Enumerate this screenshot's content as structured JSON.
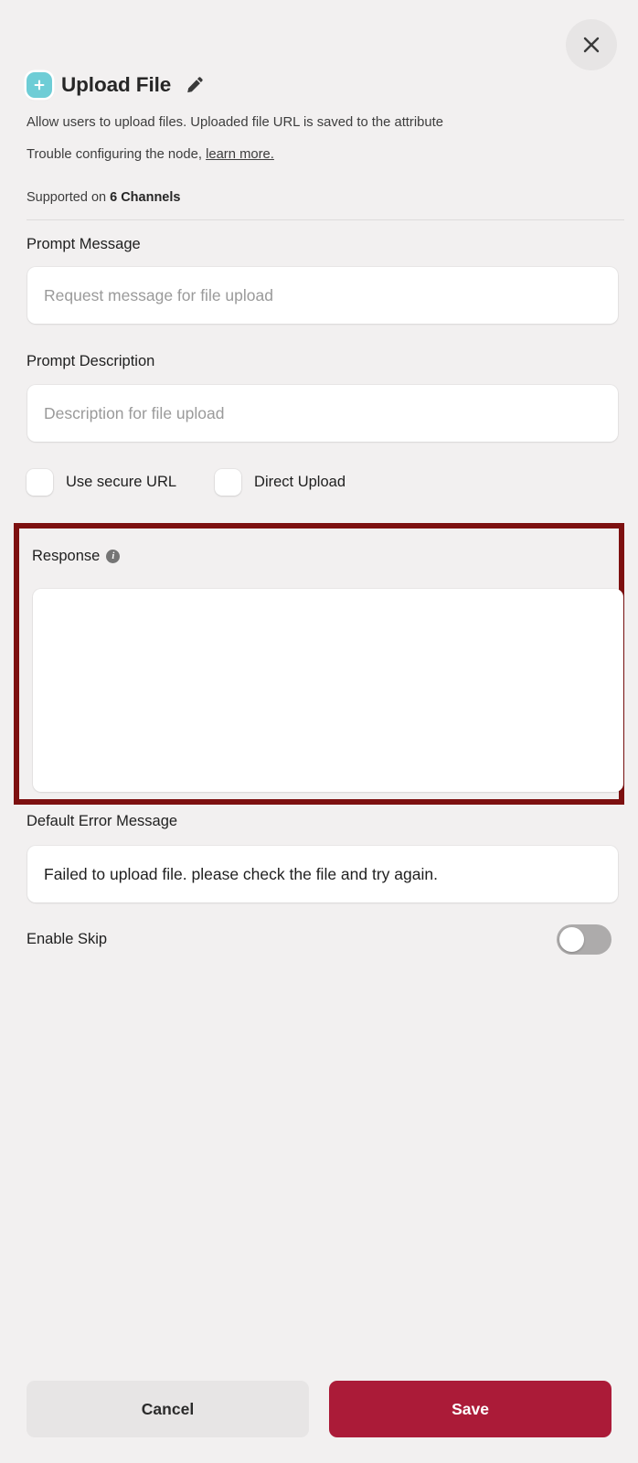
{
  "dialog": {
    "close_icon": "close-icon",
    "node_icon": "plus-square-icon",
    "title": "Upload File",
    "edit_icon": "pencil-icon",
    "description_line1": "Allow users to upload files. Uploaded file URL is saved to the attribute",
    "description_line2_prefix": "Trouble configuring the node, ",
    "learn_more_link": "learn more.",
    "channels_prefix": "Supported on ",
    "channels_value": "6 Channels"
  },
  "fields": {
    "prompt_message": {
      "label": "Prompt Message",
      "placeholder": "Request message for file upload",
      "value": ""
    },
    "prompt_description": {
      "label": "Prompt Description",
      "placeholder": "Description for file upload",
      "value": ""
    },
    "use_secure_url": {
      "label": "Use secure URL",
      "checked": false
    },
    "direct_upload": {
      "label": "Direct Upload",
      "checked": false
    },
    "response": {
      "label": "Response",
      "info_icon": "info-icon",
      "placeholder": "",
      "value": ""
    },
    "default_error_message": {
      "label": "Default Error Message",
      "placeholder": "",
      "value": "Failed to upload file. please check the file and try again."
    },
    "enable_skip": {
      "label": "Enable Skip",
      "enabled": false
    }
  },
  "footer": {
    "cancel_label": "Cancel",
    "save_label": "Save"
  },
  "colors": {
    "background": "#f2f0f0",
    "accent_save": "#ab1b38",
    "highlight_border": "#7d1010",
    "node_icon_bg": "#6ecdd6",
    "toggle_off": "#adabab"
  }
}
